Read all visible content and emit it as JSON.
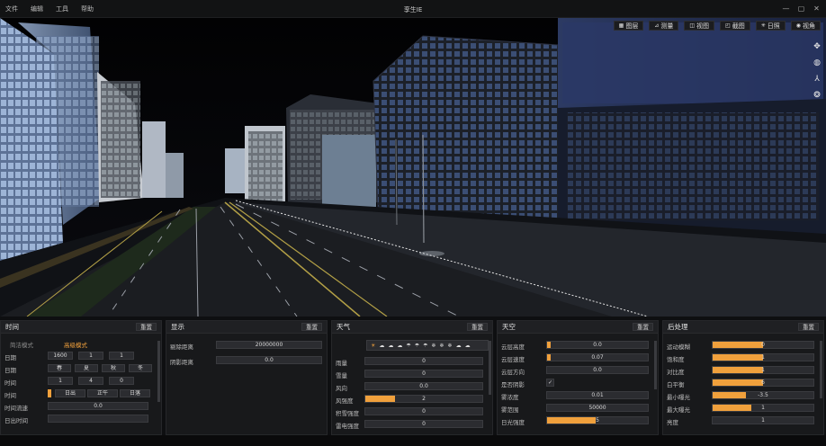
{
  "menu": [
    "文件",
    "编辑",
    "工具",
    "帮助"
  ],
  "app_title": "孪生IE",
  "viewport_toolbar": [
    {
      "icon": "layers-icon",
      "glyph": "▦",
      "label": "图层"
    },
    {
      "icon": "measure-icon",
      "glyph": "⊿",
      "label": "测量"
    },
    {
      "icon": "view-icon",
      "glyph": "◫",
      "label": "视图"
    },
    {
      "icon": "screenshot-icon",
      "glyph": "◰",
      "label": "截图"
    },
    {
      "icon": "sun-icon",
      "glyph": "✳",
      "label": "日照"
    },
    {
      "icon": "eye-icon",
      "glyph": "◉",
      "label": "视角"
    }
  ],
  "time_panel": {
    "title": "时间",
    "reset": "重置",
    "modes": [
      "简洁模式",
      "高级模式"
    ],
    "date_label": "日期",
    "date": [
      "1600",
      "1",
      "1"
    ],
    "season_label": "日期",
    "seasons": [
      "春",
      "夏",
      "秋",
      "冬"
    ],
    "time_label": "时间",
    "time": [
      "1",
      "4",
      "0"
    ],
    "tod_label": "时间",
    "tod": [
      "日出",
      "正午",
      "日落"
    ],
    "speed_label": "时间流速",
    "speed": "0.0",
    "dusk_label": "日出时间"
  },
  "display_panel": {
    "title": "显示",
    "reset": "重置",
    "rows": [
      {
        "label": "剔除距离",
        "value": "20000000"
      },
      {
        "label": "阴影距离",
        "value": "0.0"
      }
    ]
  },
  "weather_panel": {
    "title": "天气",
    "reset": "重置",
    "rows": [
      {
        "label": "雨量",
        "value": "0",
        "fill": 0
      },
      {
        "label": "雪量",
        "value": "0",
        "fill": 0
      },
      {
        "label": "风向",
        "value": "0.0",
        "fill": 0
      },
      {
        "label": "风强度",
        "value": "2",
        "fill": 0.25
      },
      {
        "label": "积雪强度",
        "value": "0",
        "fill": 0
      },
      {
        "label": "雷电强度",
        "value": "0",
        "fill": 0
      }
    ]
  },
  "sky_panel": {
    "title": "天空",
    "reset": "重置",
    "rows": [
      {
        "label": "云层高度",
        "value": "0.0",
        "fill": 0.04,
        "kind": "slider"
      },
      {
        "label": "云层速度",
        "value": "0.07",
        "fill": 0.04,
        "kind": "slider"
      },
      {
        "label": "云层方向",
        "value": "0.0",
        "fill": 0,
        "kind": "slider"
      },
      {
        "label": "是否阴影",
        "value": "✓",
        "fill": 0,
        "kind": "check"
      },
      {
        "label": "雾浓度",
        "value": "0.01",
        "fill": 0,
        "kind": "slider"
      },
      {
        "label": "雾范围",
        "value": "50000",
        "fill": 0,
        "kind": "slider"
      },
      {
        "label": "日光强度",
        "value": "5",
        "fill": 0.48,
        "kind": "slider"
      }
    ]
  },
  "post_panel": {
    "title": "后处理",
    "reset": "重置",
    "rows": [
      {
        "label": "运动模糊",
        "value": "0",
        "fill": 0.5
      },
      {
        "label": "饱和度",
        "value": "1",
        "fill": 0.5
      },
      {
        "label": "对比度",
        "value": "1",
        "fill": 0.5
      },
      {
        "label": "白平衡",
        "value": "6",
        "fill": 0.5
      },
      {
        "label": "最小曝光",
        "value": "-3.5",
        "fill": 0.33
      },
      {
        "label": "最大曝光",
        "value": "1",
        "fill": 0.38
      },
      {
        "label": "亮度",
        "value": "1",
        "fill": 0.0
      }
    ]
  },
  "colors": {
    "accent": "#f0a03c",
    "panel_bg": "#18191b",
    "field_bg": "#2b2c30"
  }
}
